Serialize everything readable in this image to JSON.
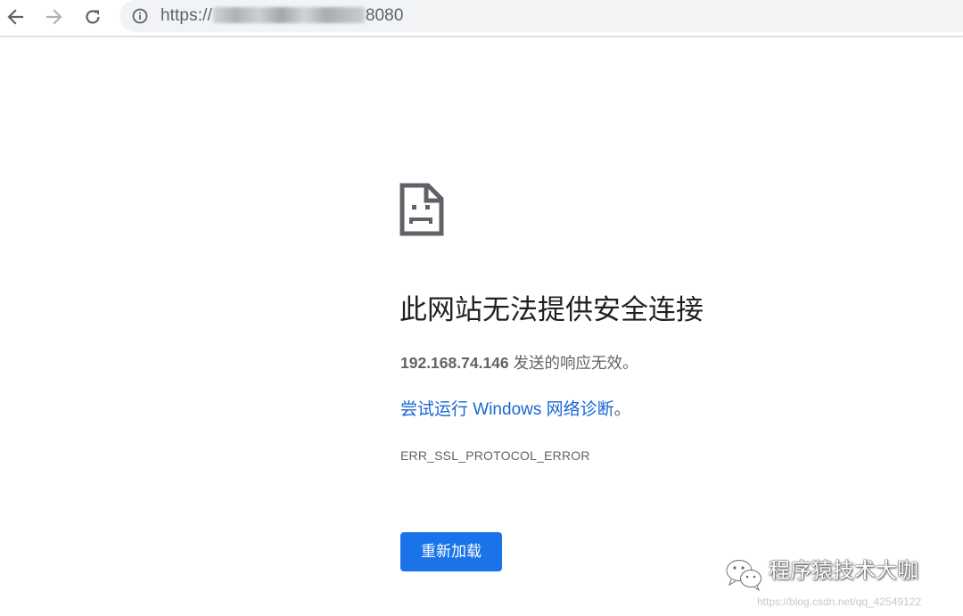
{
  "browser": {
    "url_prefix": "https://",
    "url_port": "8080",
    "icons": {
      "back": "back-arrow-icon",
      "forward": "forward-arrow-icon",
      "reload": "reload-icon",
      "info": "info-circle-icon"
    }
  },
  "error_page": {
    "icon": "sad-page-icon",
    "heading": "此网站无法提供安全连接",
    "host": "192.168.74.146",
    "message_suffix": " 发送的响应无效。",
    "suggestion_link": "尝试运行 Windows 网络诊断",
    "suggestion_period": "。",
    "error_code": "ERR_SSL_PROTOCOL_ERROR",
    "reload_button": "重新加载"
  },
  "watermark": {
    "name": "程序猿技术大咖",
    "url": "https://blog.csdn.net/qq_42549122",
    "icon": "wechat-logo-icon"
  },
  "colors": {
    "accent": "#1a73e8",
    "link": "#1967d2",
    "text_secondary": "#5f6368",
    "omnibox_bg": "#f1f3f4"
  }
}
